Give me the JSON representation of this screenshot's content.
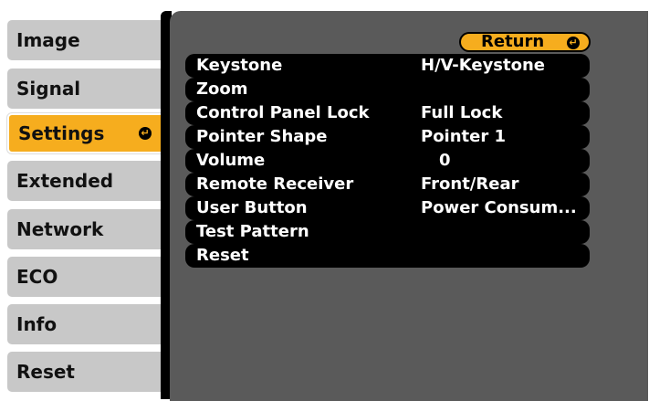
{
  "sidebar": {
    "items": [
      {
        "label": "Image"
      },
      {
        "label": "Signal"
      },
      {
        "label": "Settings",
        "active": true
      },
      {
        "label": "Extended"
      },
      {
        "label": "Network"
      },
      {
        "label": "ECO"
      },
      {
        "label": "Info"
      },
      {
        "label": "Reset"
      }
    ]
  },
  "panel": {
    "return_label": "Return",
    "rows": [
      {
        "label": "Keystone",
        "value": "H/V-Keystone"
      },
      {
        "label": "Zoom",
        "value": ""
      },
      {
        "label": "Control Panel Lock",
        "value": "Full Lock"
      },
      {
        "label": "Pointer Shape",
        "value": "Pointer 1"
      },
      {
        "label": "Volume",
        "value": "0"
      },
      {
        "label": "Remote Receiver",
        "value": "Front/Rear"
      },
      {
        "label": "User Button",
        "value": "Power Consum..."
      },
      {
        "label": "Test Pattern",
        "value": ""
      },
      {
        "label": "Reset",
        "value": ""
      }
    ]
  },
  "colors": {
    "accent": "#f6ad1e",
    "tab_bg": "#c8c8c8",
    "panel_bg": "#5a5a5a",
    "row_bg": "#000000"
  },
  "icons": {
    "enter": "enter-icon"
  }
}
